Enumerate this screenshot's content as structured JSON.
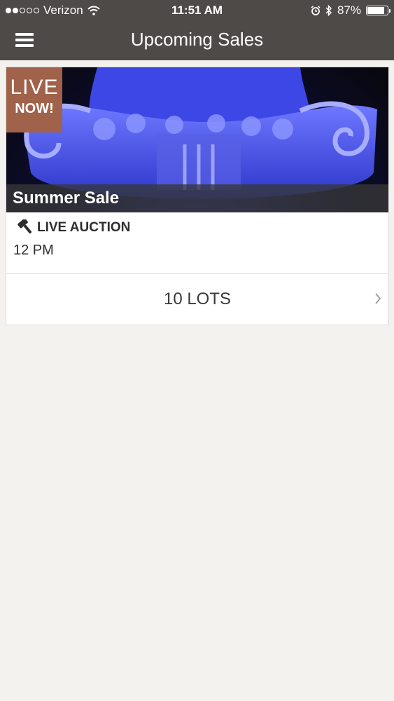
{
  "status_bar": {
    "carrier": "Verizon",
    "time": "11:51 AM",
    "battery_percent": "87%",
    "battery_level": 0.87,
    "signal_bars_filled": 2,
    "signal_bars_total": 5
  },
  "nav": {
    "title": "Upcoming Sales",
    "menu_icon": "hamburger-menu-icon"
  },
  "sale": {
    "badge_line1": "LIVE",
    "badge_line2": "NOW!",
    "title": "Summer Sale",
    "auction_icon": "gavel-icon",
    "auction_type": "LIVE AUCTION",
    "time": "12 PM",
    "lots_label": "10 LOTS",
    "chevron_icon": "chevron-right-icon"
  },
  "colors": {
    "bar_background": "#4d4a48",
    "page_background": "#f3f2ef",
    "live_badge": "#a0624a",
    "text_dark": "#2d2d2d"
  }
}
